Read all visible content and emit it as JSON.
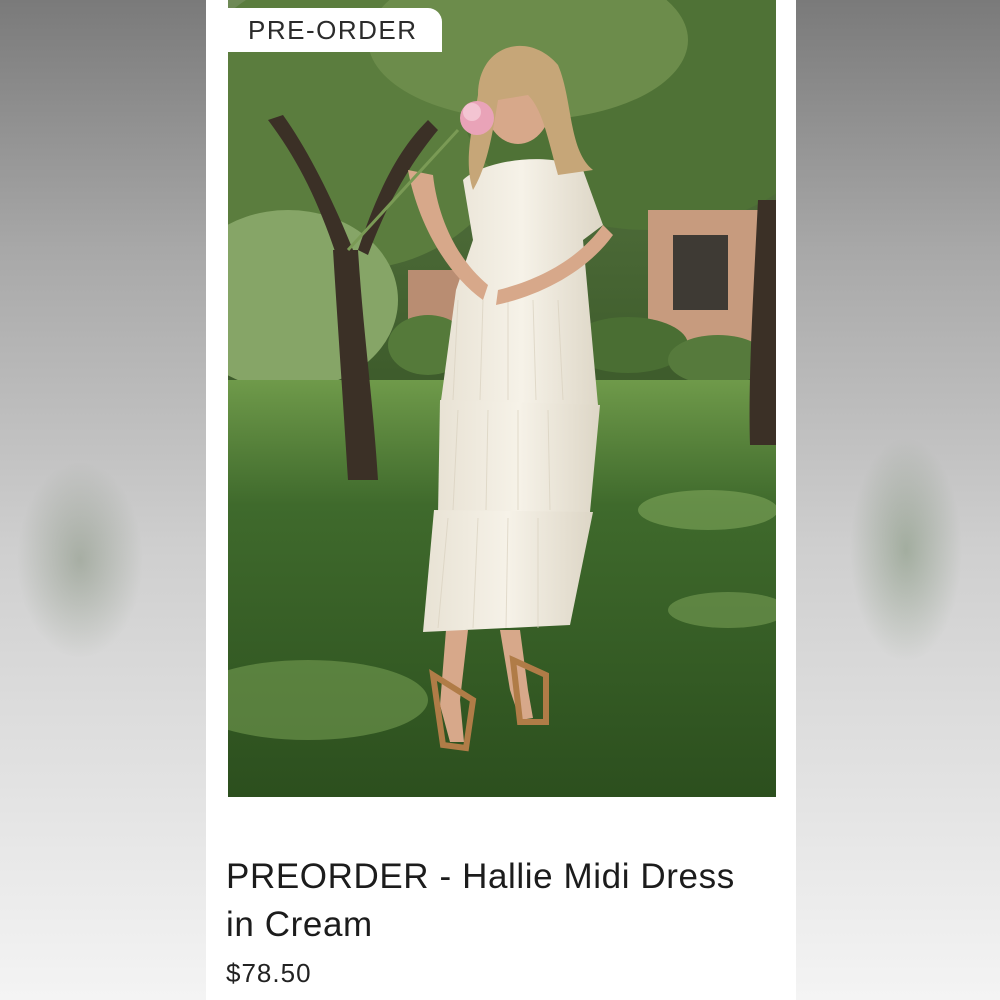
{
  "badge": {
    "label": "PRE-ORDER"
  },
  "product": {
    "title": "PREORDER - Hallie Midi Dress in Cream",
    "price": "$78.50"
  },
  "image": {
    "subject": "product-photo"
  },
  "colors": {
    "card": "#ffffff",
    "text": "#1c1c1c",
    "grass": "#3f6a2c"
  }
}
